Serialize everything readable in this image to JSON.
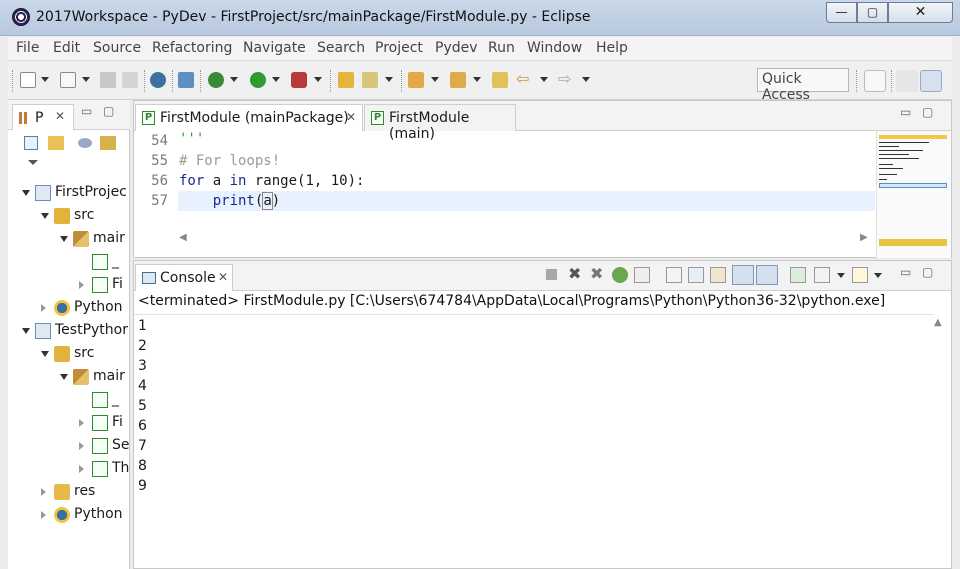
{
  "window": {
    "title": "2017Workspace - PyDev - FirstProject/src/mainPackage/FirstModule.py - Eclipse",
    "minimize": "—",
    "maximize": "▢",
    "close": "✕"
  },
  "menu": [
    "File",
    "Edit",
    "Source",
    "Refactoring",
    "Navigate",
    "Search",
    "Project",
    "Pydev",
    "Run",
    "Window",
    "Help"
  ],
  "toolbar": {
    "quick_access": "Quick Access"
  },
  "explorer": {
    "tab_label": "P",
    "tree": [
      {
        "label": "FirstProjec",
        "depth": 0,
        "state": "open",
        "icon": "project-icon"
      },
      {
        "label": "src",
        "depth": 1,
        "state": "open",
        "icon": "source-folder-icon"
      },
      {
        "label": "mair",
        "depth": 2,
        "state": "open",
        "icon": "package-icon"
      },
      {
        "label": "_",
        "depth": 3,
        "state": "none",
        "icon": "python-file-icon"
      },
      {
        "label": "Fi",
        "depth": 3,
        "state": "closed",
        "icon": "python-file-icon"
      },
      {
        "label": "Python",
        "depth": 1,
        "state": "closed",
        "icon": "python-interpreter-icon"
      },
      {
        "label": "TestPythor",
        "depth": 0,
        "state": "open",
        "icon": "project-icon"
      },
      {
        "label": "src",
        "depth": 1,
        "state": "open",
        "icon": "source-folder-icon"
      },
      {
        "label": "mair",
        "depth": 2,
        "state": "open",
        "icon": "package-icon"
      },
      {
        "label": "_",
        "depth": 3,
        "state": "none",
        "icon": "python-file-icon"
      },
      {
        "label": "Fi",
        "depth": 3,
        "state": "closed",
        "icon": "python-file-icon"
      },
      {
        "label": "Se",
        "depth": 3,
        "state": "closed",
        "icon": "python-file-icon"
      },
      {
        "label": "Th",
        "depth": 3,
        "state": "closed",
        "icon": "python-file-icon"
      },
      {
        "label": "res",
        "depth": 1,
        "state": "closed",
        "icon": "folder-icon"
      },
      {
        "label": "Python",
        "depth": 1,
        "state": "closed",
        "icon": "python-interpreter-icon"
      }
    ]
  },
  "editor": {
    "tabs": [
      {
        "label": "FirstModule (mainPackage)",
        "active": true
      },
      {
        "label": "FirstModule (main)",
        "active": false
      }
    ],
    "lines": [
      {
        "num": "54",
        "code": "'''"
      },
      {
        "num": "55",
        "code": "# For loops!"
      },
      {
        "num": "56",
        "code": "for a in range(1, 10):"
      },
      {
        "num": "57",
        "code": "    print(a)"
      }
    ]
  },
  "console": {
    "tab_label": "Console",
    "status": "<terminated> FirstModule.py [C:\\Users\\674784\\AppData\\Local\\Programs\\Python\\Python36-32\\python.exe]",
    "output": [
      "1",
      "2",
      "3",
      "4",
      "5",
      "6",
      "7",
      "8",
      "9"
    ]
  },
  "colors": {
    "keyword": "#7f0055",
    "comment": "#9a9a9a",
    "number": "#000000",
    "builtin": "#3f3fbf",
    "highlight_row": "#e8f2fe"
  }
}
